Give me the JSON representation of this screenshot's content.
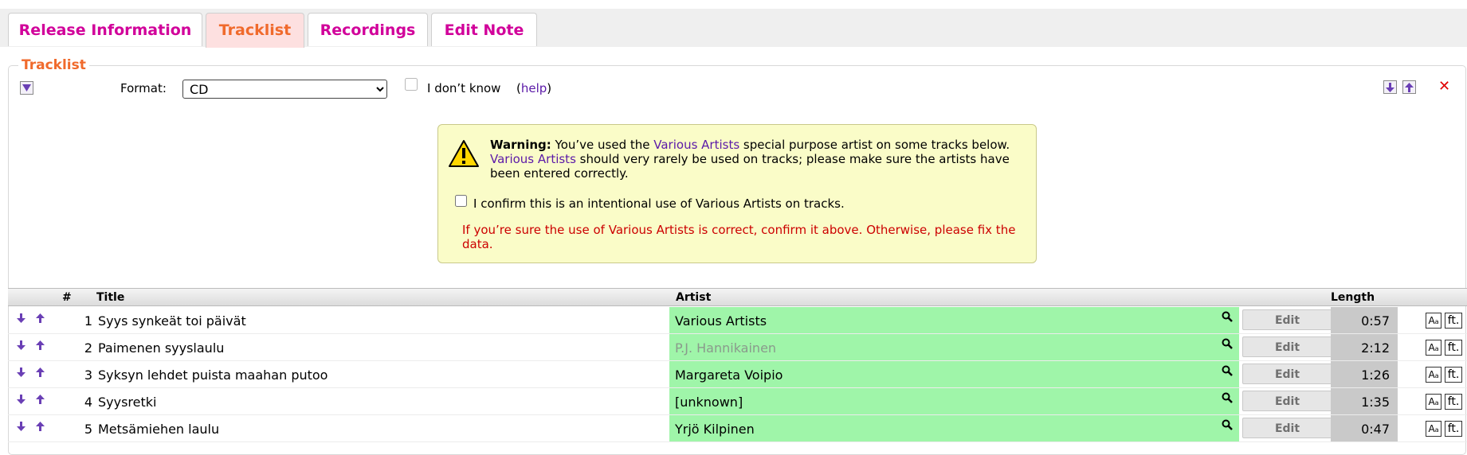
{
  "tabs": [
    {
      "label": "Release Information",
      "active": false
    },
    {
      "label": "Tracklist",
      "active": true
    },
    {
      "label": "Recordings",
      "active": false
    },
    {
      "label": "Edit Note",
      "active": false
    }
  ],
  "tracklist": {
    "legend": "Tracklist",
    "format_label": "Format:",
    "format_value": "CD",
    "dont_know_label": "I don’t know",
    "help_open": "(",
    "help_link": "help",
    "help_close": ")",
    "remove_icon": "✕"
  },
  "warning": {
    "strong": "Warning:",
    "line1_pre": " You’ve used the ",
    "va_link_1": "Various Artists",
    "line1_post": " special purpose artist on some tracks below.",
    "va_link_2": "Various Artists",
    "line2": " should very rarely be used on tracks; please make sure the artists have been entered correctly.",
    "confirm_label": "I confirm this is an intentional use of Various Artists on tracks.",
    "error": "If you’re sure the use of Various Artists is correct, confirm it above. Otherwise, please fix the data."
  },
  "table": {
    "headers": {
      "num": "#",
      "title": "Title",
      "artist": "Artist",
      "length": "Length"
    },
    "edit_label": "Edit",
    "ft_label": "ft.",
    "rows": [
      {
        "num": "1",
        "title": "Syys synkeät toi päivät",
        "artist": "Various Artists",
        "placeholder": false,
        "length": "0:57"
      },
      {
        "num": "2",
        "title": "Paimenen syyslaulu",
        "artist": "P.J. Hannikainen",
        "placeholder": true,
        "length": "2:12"
      },
      {
        "num": "3",
        "title": "Syksyn lehdet puista maahan putoo",
        "artist": "Margareta Voipio",
        "placeholder": false,
        "length": "1:26"
      },
      {
        "num": "4",
        "title": "Syysretki",
        "artist": "[unknown]",
        "placeholder": false,
        "length": "1:35"
      },
      {
        "num": "5",
        "title": "Metsämiehen laulu",
        "artist": "Yrjö Kilpinen",
        "placeholder": false,
        "length": "0:47"
      }
    ]
  },
  "colors": {
    "accent": "#d1009a",
    "active_tab": "#f06a2c",
    "artist_bg": "#9ff5a9",
    "link": "#5b19a8",
    "error": "#cc0000"
  }
}
